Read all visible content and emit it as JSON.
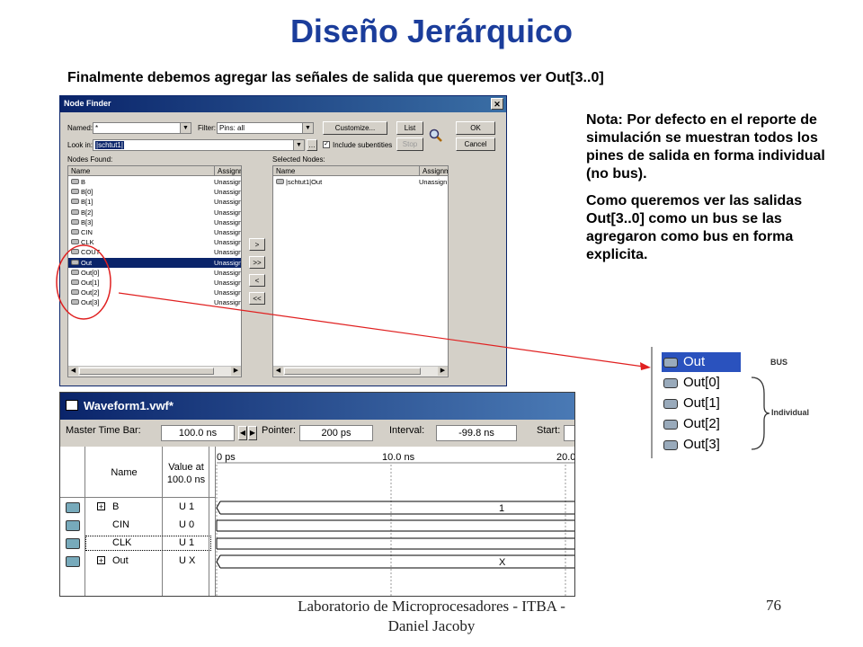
{
  "slide": {
    "title": "Diseño Jerárquico",
    "subtitle": "Finalmente debemos agregar las señales de salida que queremos ver Out[3..0]",
    "note_1": "Nota: Por defecto en el reporte de simulación se muestran todos los pines de salida en forma individual (no bus).",
    "note_2": "Como queremos ver las salidas Out[3..0] como un bus se las agregaron como bus en forma explicita.",
    "footer": "Laboratorio de Microprocesadores - ITBA -Daniel Jacoby",
    "page_number": "76"
  },
  "node_finder": {
    "title": "Node Finder",
    "named_label": "Named:",
    "named_value": "*",
    "filter_label": "Filter:",
    "filter_value": "Pins: all",
    "lookin_label": "Look in:",
    "lookin_value": "|schtut1|",
    "include_sub": "Include subentities",
    "customize_btn": "Customize...",
    "list_btn": "List",
    "stop_btn": "Stop",
    "ok_btn": "OK",
    "cancel_btn": "Cancel",
    "nodes_found_label": "Nodes Found:",
    "selected_nodes_label": "Selected Nodes:",
    "col_name": "Name",
    "col_assign": "Assignm",
    "nodes": [
      {
        "name": "B",
        "assign": "Unassign"
      },
      {
        "name": "B[0]",
        "assign": "Unassign"
      },
      {
        "name": "B[1]",
        "assign": "Unassign"
      },
      {
        "name": "B[2]",
        "assign": "Unassign"
      },
      {
        "name": "B[3]",
        "assign": "Unassign"
      },
      {
        "name": "CIN",
        "assign": "Unassign"
      },
      {
        "name": "CLK",
        "assign": "Unassign"
      },
      {
        "name": "COUT",
        "assign": "Unassign"
      },
      {
        "name": "Out",
        "assign": "Unassign"
      },
      {
        "name": "Out[0]",
        "assign": "Unassign"
      },
      {
        "name": "Out[1]",
        "assign": "Unassign"
      },
      {
        "name": "Out[2]",
        "assign": "Unassign"
      },
      {
        "name": "Out[3]",
        "assign": "Unassign"
      }
    ],
    "selected": [
      {
        "name": "|schtut1|Out",
        "assign": "Unassign"
      }
    ],
    "move_buttons": [
      ">",
      ">>",
      "<",
      "<<"
    ]
  },
  "waveform": {
    "title": "Waveform1.vwf*",
    "master_label": "Master Time Bar:",
    "master_value": "100.0 ns",
    "pointer_label": "Pointer:",
    "pointer_value": "200 ps",
    "interval_label": "Interval:",
    "interval_value": "-99.8 ns",
    "start_label": "Start:",
    "col_name": "Name",
    "col_value": "Value at 100.0 ns",
    "time_ticks": [
      "0 ps",
      "10.0 ns",
      "20.0"
    ],
    "signals": [
      {
        "name": "B",
        "value": "U 1",
        "bus_value": "1",
        "expandable": true
      },
      {
        "name": "CIN",
        "value": "U 0",
        "bus_value": "",
        "expandable": false
      },
      {
        "name": "CLK",
        "value": "U 1",
        "bus_value": "",
        "expandable": false
      },
      {
        "name": "Out",
        "value": "U X",
        "bus_value": "X",
        "expandable": true
      }
    ]
  },
  "inset": {
    "items": [
      "Out",
      "Out[0]",
      "Out[1]",
      "Out[2]",
      "Out[3]"
    ],
    "bus_label": "BUS",
    "individual_label": "Individual"
  },
  "colors": {
    "title": "#1b3d9b",
    "selection": "#0a246a",
    "annotation": "#e02020"
  }
}
